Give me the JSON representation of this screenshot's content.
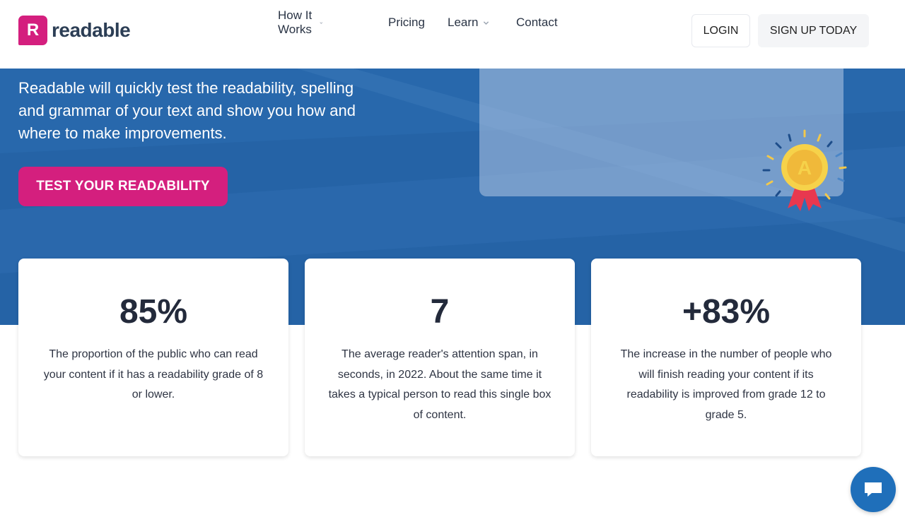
{
  "brand": {
    "logo_letter": "R",
    "name": "readable",
    "accent": "#d41f7e",
    "hero_bg": "#2563a6"
  },
  "nav": {
    "items": [
      {
        "label": "How It Works",
        "has_dropdown": true
      },
      {
        "label": "Pricing",
        "has_dropdown": false
      },
      {
        "label": "Learn",
        "has_dropdown": true
      },
      {
        "label": "Contact",
        "has_dropdown": false
      }
    ],
    "login_label": "LOGIN",
    "signup_label": "SIGN UP TODAY"
  },
  "hero": {
    "text": "Readable will quickly test the readability, spelling and grammar of your text and show you how and where to make improvements.",
    "cta_label": "TEST YOUR READABILITY",
    "medal_letter": "A"
  },
  "stats": [
    {
      "value": "85%",
      "description": "The proportion of the public who can read your content if it has a readability grade of 8 or lower."
    },
    {
      "value": "7",
      "description": "The average reader's attention span, in seconds, in 2022. About the same time it takes a typical person to read this single box of content."
    },
    {
      "value": "+83%",
      "description": "The increase in the number of people who will finish reading your content if its readability is improved from grade 12 to grade 5."
    }
  ],
  "chat": {
    "icon": "chat-bubble-icon"
  }
}
